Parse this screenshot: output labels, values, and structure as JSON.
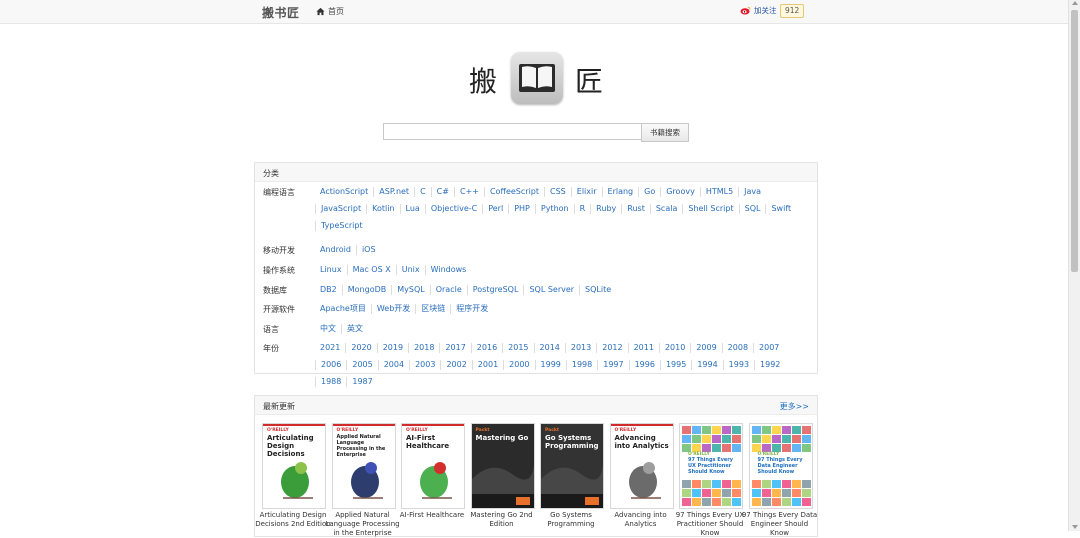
{
  "header": {
    "brand": "搬书匠",
    "home_label": "首页",
    "follow_label": "加关注",
    "follow_count": "912"
  },
  "logo": {
    "left": "搬",
    "right": "匠"
  },
  "search": {
    "placeholder": "",
    "button_label": "书籍搜索"
  },
  "categories": {
    "title": "分类",
    "rows": [
      {
        "label": "编程语言",
        "items": [
          "ActionScript",
          "ASP.net",
          "C",
          "C#",
          "C++",
          "CoffeeScript",
          "CSS",
          "Elixir",
          "Erlang",
          "Go",
          "Groovy",
          "HTML5",
          "Java",
          "JavaScript",
          "Kotlin",
          "Lua",
          "Objective-C",
          "Perl",
          "PHP",
          "Python",
          "R",
          "Ruby",
          "Rust",
          "Scala",
          "Shell Script",
          "SQL",
          "Swift",
          "TypeScript"
        ]
      },
      {
        "label": "移动开发",
        "items": [
          "Android",
          "iOS"
        ]
      },
      {
        "label": "操作系统",
        "items": [
          "Linux",
          "Mac OS X",
          "Unix",
          "Windows"
        ]
      },
      {
        "label": "数据库",
        "items": [
          "DB2",
          "MongoDB",
          "MySQL",
          "Oracle",
          "PostgreSQL",
          "SQL Server",
          "SQLite"
        ]
      },
      {
        "label": "开源软件",
        "items": [
          "Apache项目",
          "Web开发",
          "区块链",
          "程序开发"
        ]
      },
      {
        "label": "语言",
        "items": [
          "中文",
          "英文"
        ]
      },
      {
        "label": "年份",
        "items": [
          "2021",
          "2020",
          "2019",
          "2018",
          "2017",
          "2016",
          "2015",
          "2014",
          "2013",
          "2012",
          "2011",
          "2010",
          "2009",
          "2008",
          "2007",
          "2006",
          "2005",
          "2004",
          "2003",
          "2002",
          "2001",
          "2000",
          "1999",
          "1998",
          "1997",
          "1996",
          "1995",
          "1994",
          "1993",
          "1992",
          "1988",
          "1987"
        ]
      }
    ]
  },
  "recent": {
    "title": "最新更新",
    "more_label": "更多>>",
    "books": [
      {
        "title": "Articulating Design Decisions 2nd Edition",
        "cover_text": "Articulating Design Decisions",
        "publisher": "O'REILLY",
        "bg": "#ffffff",
        "fg": "#222222",
        "accent": "#d22b2b"
      },
      {
        "title": "Applied Natural Language Processing in the Enterprise",
        "cover_text": "Applied Natural Language Processing in the Enterprise",
        "publisher": "O'REILLY",
        "bg": "#ffffff",
        "fg": "#222222",
        "accent": "#d22b2b"
      },
      {
        "title": "AI-First Healthcare",
        "cover_text": "AI-First Healthcare",
        "publisher": "O'REILLY",
        "bg": "#ffffff",
        "fg": "#222222",
        "accent": "#d22b2b"
      },
      {
        "title": "Mastering Go 2nd Edition",
        "cover_text": "Mastering Go",
        "publisher": "Packt",
        "bg": "#2b2b2b",
        "fg": "#ffffff",
        "accent": "#e8702a"
      },
      {
        "title": "Go Systems Programming",
        "cover_text": "Go Systems Programming",
        "publisher": "Packt",
        "bg": "#333333",
        "fg": "#ffffff",
        "accent": "#e8702a"
      },
      {
        "title": "Advancing into Analytics",
        "cover_text": "Advancing into Analytics",
        "publisher": "O'REILLY",
        "bg": "#ffffff",
        "fg": "#222222",
        "accent": "#d22b2b"
      },
      {
        "title": "97 Things Every UX Practitioner Should Know",
        "cover_text": "97 Things Every UX Practitioner Should Know",
        "publisher": "O'REILLY",
        "bg": "#ffffff",
        "fg": "#1f6fbf",
        "accent": "#7cb342"
      },
      {
        "title": "97 Things Every Data Engineer Should Know",
        "cover_text": "97 Things Every Data Engineer Should Know",
        "publisher": "O'REILLY",
        "bg": "#ffffff",
        "fg": "#1f6fbf",
        "accent": "#7cb342"
      }
    ]
  }
}
